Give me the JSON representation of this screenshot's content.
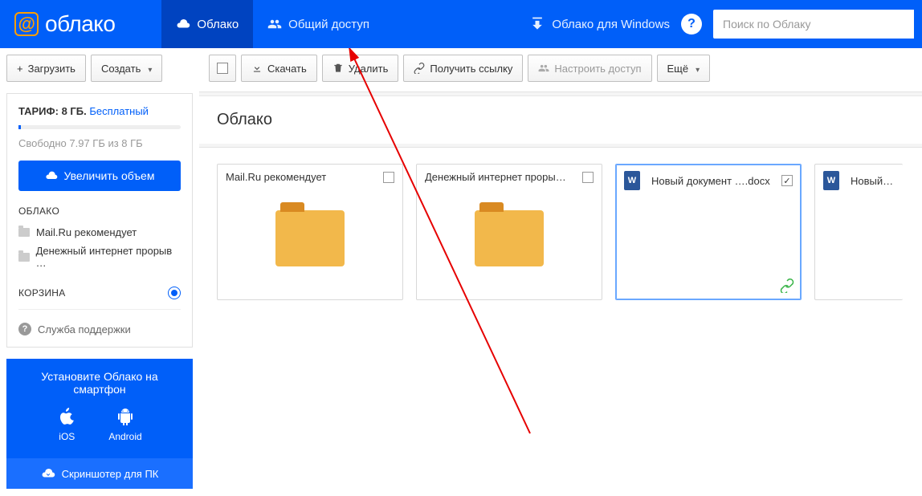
{
  "header": {
    "logo_text": "облако",
    "tabs": [
      {
        "label": "Облако"
      },
      {
        "label": "Общий доступ"
      }
    ],
    "windows_link": "Облако для Windows",
    "search_placeholder": "Поиск по Облаку"
  },
  "sidebar_toolbar": {
    "upload": "Загрузить",
    "create": "Создать"
  },
  "main_toolbar": {
    "download": "Скачать",
    "delete": "Удалить",
    "get_link": "Получить ссылку",
    "share": "Настроить доступ",
    "more": "Ещё"
  },
  "tariff": {
    "label": "ТАРИФ:",
    "size": "8 ГБ.",
    "plan": "Бесплатный",
    "free_text": "Свободно 7.97 ГБ из 8 ГБ",
    "enlarge": "Увеличить объем"
  },
  "tree": {
    "cloud_title": "ОБЛАКО",
    "items": [
      "Mail.Ru рекомендует",
      "Денежный интернет прорыв …"
    ],
    "trash_title": "КОРЗИНА"
  },
  "support": "Служба поддержки",
  "promo": {
    "title": "Установите Облако на смартфон",
    "ios": "iOS",
    "android": "Android",
    "screenshoter": "Скриншотер для ПК"
  },
  "breadcrumb": "Облако",
  "cards": [
    {
      "title": "Mail.Ru рекомендует",
      "type": "folder",
      "checked": false
    },
    {
      "title": "Денежный интернет проры…",
      "type": "folder",
      "checked": false
    },
    {
      "title": "Новый документ ….docx",
      "type": "doc",
      "checked": true,
      "selected": true,
      "shared": true
    },
    {
      "title": "Новый докум",
      "type": "doc",
      "checked": false,
      "clipped": true
    }
  ]
}
